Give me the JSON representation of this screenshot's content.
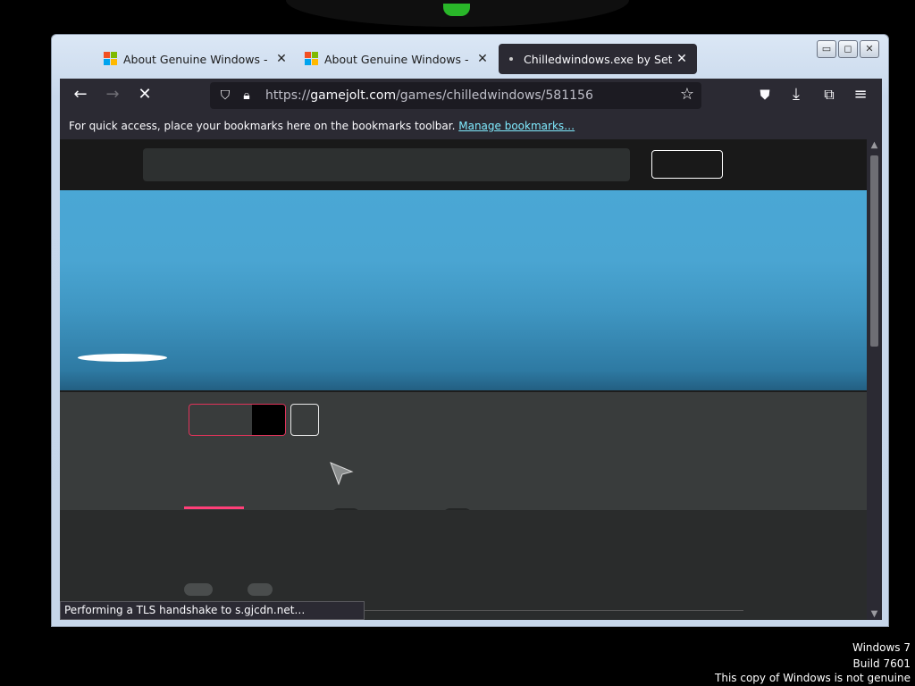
{
  "browser": {
    "tabs": [
      {
        "title": "About Genuine Windows - Microsoft",
        "icon": "microsoft-logo-icon",
        "active": false
      },
      {
        "title": "About Genuine Windows - Microsoft",
        "icon": "microsoft-logo-icon",
        "active": false
      },
      {
        "title": "Chilledwindows.exe by Sethnoe",
        "icon": "loading-dot-icon",
        "active": true
      }
    ],
    "tab_close_glyph": "✕",
    "window_buttons": {
      "minimize": "▭",
      "maximize": "◻",
      "close": "✕"
    },
    "url": {
      "prefix": "https://",
      "host": "gamejolt.com",
      "path": "/games/chilledwindows/581156"
    },
    "nav_icons": [
      "back-arrow-icon",
      "forward-arrow-icon",
      "stop-loading-icon"
    ],
    "bookmarks_bar": {
      "text": "For quick access, place your bookmarks here on the bookmarks toolbar.",
      "link": "Manage bookmarks…"
    },
    "status": "Performing a TLS handshake to s.gjcdn.net…"
  },
  "watermark": {
    "line1": "Windows 7",
    "line2": "Build 7601",
    "line3": "This copy of Windows is not genuine"
  },
  "colors": {
    "accent_pink": "#ff3f78",
    "banner_blue": "#4aa7d5",
    "browser_dark": "#2b2a33"
  }
}
